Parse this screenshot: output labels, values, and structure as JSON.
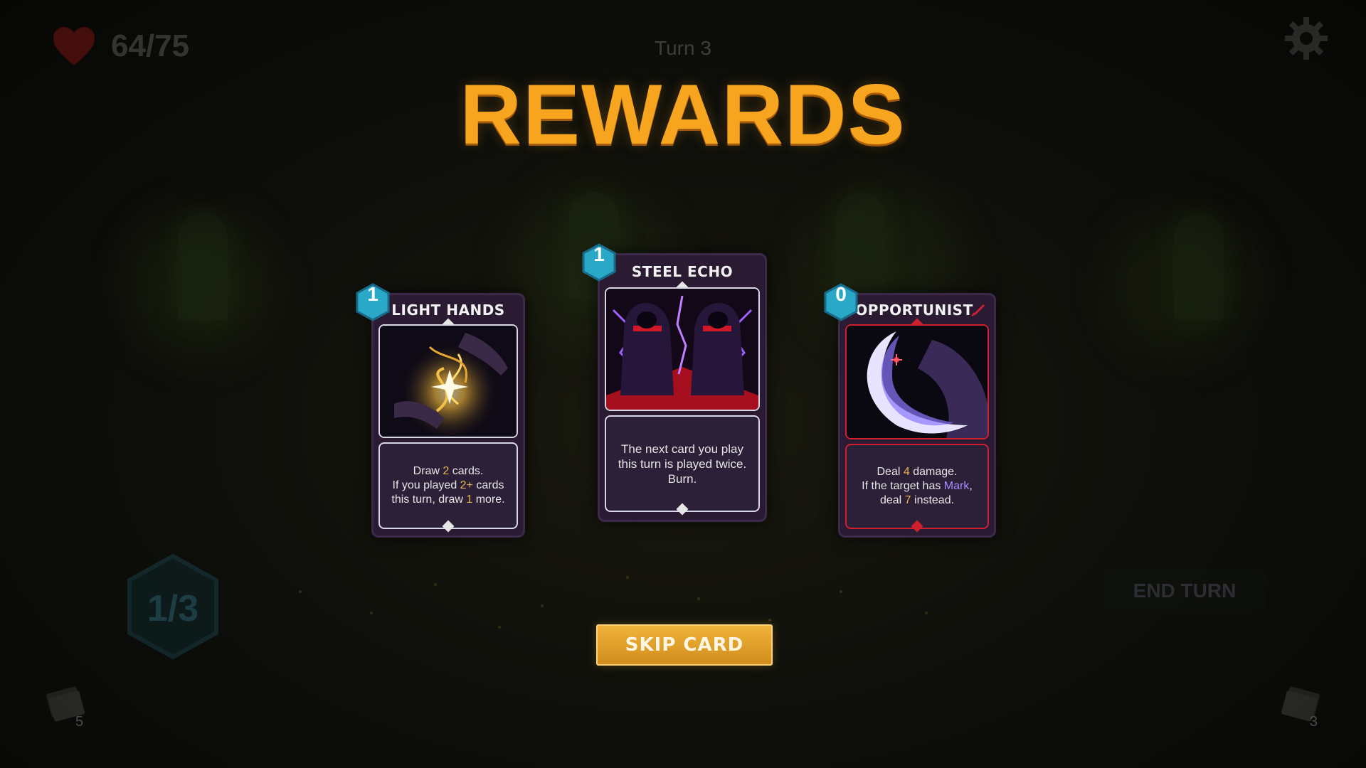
{
  "hud": {
    "hp": "64/75",
    "turn": "Turn 3",
    "energy": "1/3",
    "deck_count": "5",
    "discard_count": "3",
    "end_turn_label": "END TURN"
  },
  "title": "REWARDS",
  "cards": [
    {
      "cost": "1",
      "name": "LIGHT HANDS",
      "desc_parts": [
        "Draw ",
        "2",
        " cards.",
        "If you played ",
        "2+",
        " cards",
        "this turn, draw ",
        "1",
        " more."
      ]
    },
    {
      "cost": "1",
      "name": "STEEL ECHO",
      "desc_lines": [
        "The next card you play",
        "this turn is played twice.",
        "Burn."
      ]
    },
    {
      "cost": "0",
      "name": "OPPORTUNIST",
      "desc_parts": [
        "Deal ",
        "4",
        " damage.",
        "If the target has ",
        "Mark",
        ",",
        "deal ",
        "7",
        " instead."
      ]
    }
  ],
  "skip_label": "SKIP CARD",
  "colors": {
    "title": "#f7a51e",
    "card_bg": "#2a1b33",
    "cost_gem": "#2aa8c8",
    "highlight": "#e7b34a",
    "keyword": "#a98bff",
    "button": "#e0a02a"
  },
  "icons": [
    "heart-icon",
    "gear-icon",
    "deck-icon",
    "discard-icon",
    "energy-hex-icon",
    "blade-icon"
  ]
}
